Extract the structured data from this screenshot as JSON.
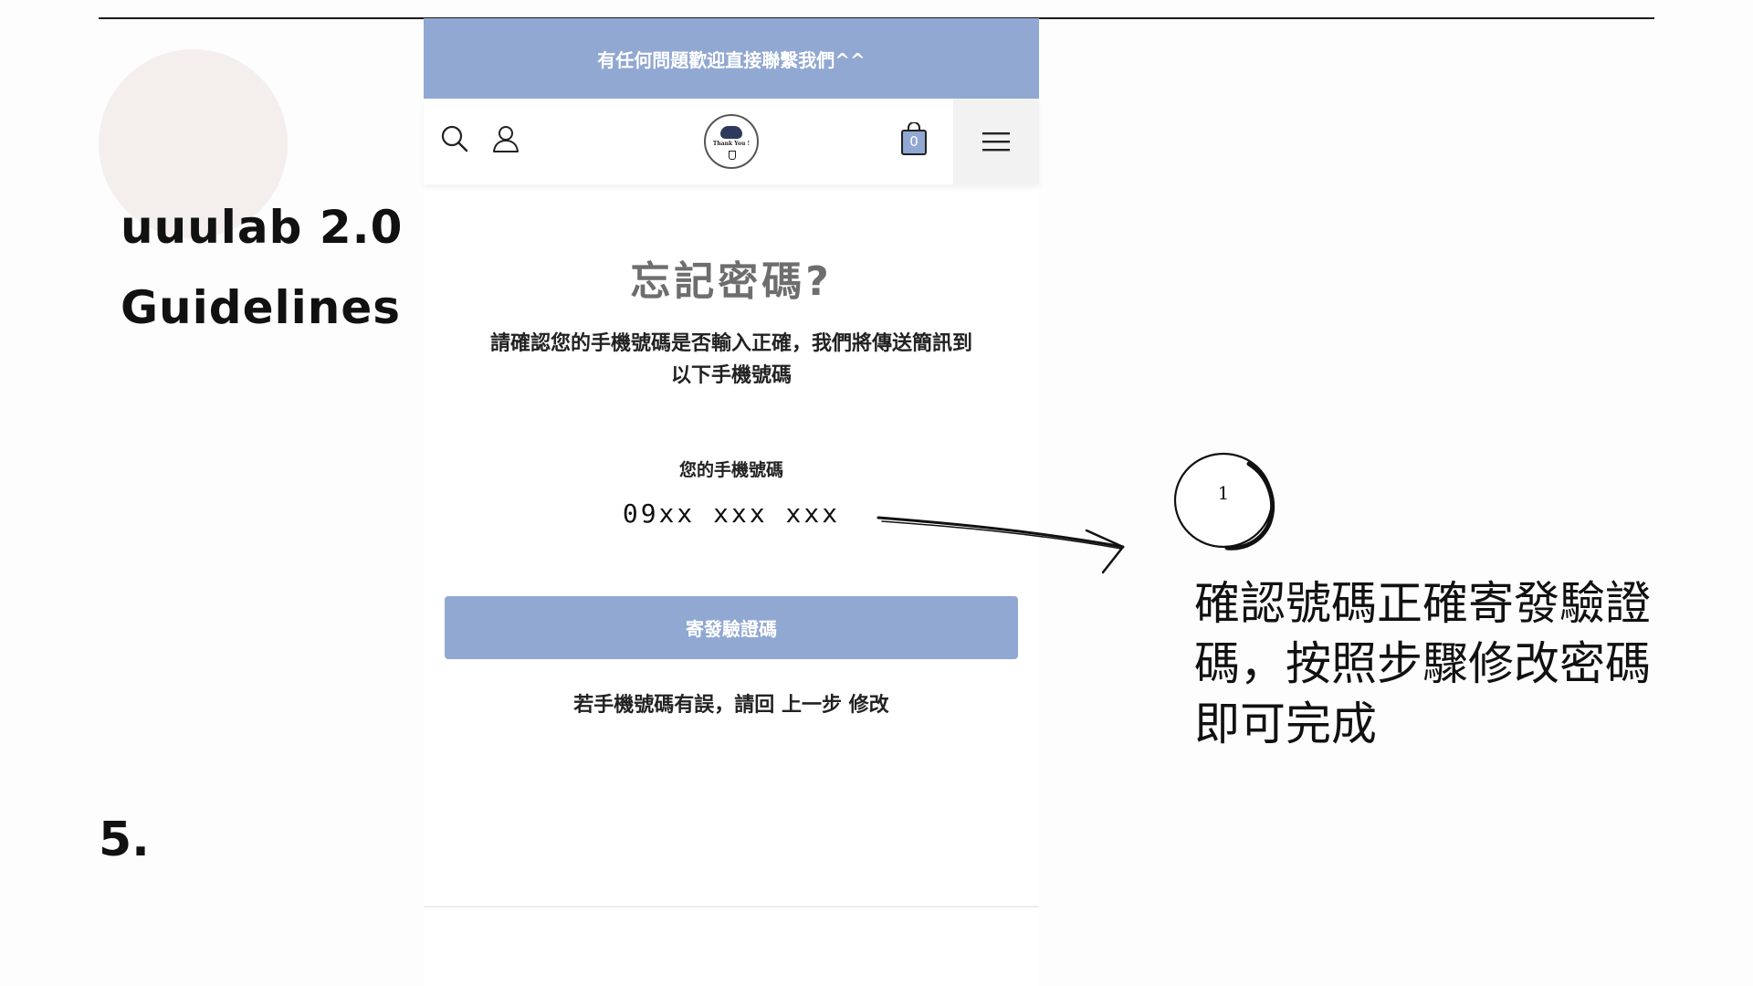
{
  "slide": {
    "title_line1": "uuulab 2.0",
    "title_line2": "Guidelines",
    "step_number": "5.",
    "step_badge": "1",
    "annotation_line1": "確認號碼正確寄發驗證",
    "annotation_line2": "碼，按照步驟修改密碼",
    "annotation_line3": "即可完成"
  },
  "phone": {
    "announcement": "有任何問題歡迎直接聯繫我們^^",
    "header": {
      "search_icon": "search-icon",
      "account_icon": "user-icon",
      "logo_text": "Thank You !",
      "cart_count": "0",
      "menu_icon": "hamburger-menu-icon"
    },
    "page_title": "忘記密碼?",
    "instructions_line1": "請確認您的手機號碼是否輸入正確，我們將傳送簡訊到",
    "instructions_line2": "以下手機號碼",
    "phone_label": "您的手機號碼",
    "phone_value": "09xx xxx xxx",
    "send_button_label": "寄發驗證碼",
    "back_prefix": "若手機號碼有誤，請回",
    "back_link": "上一步",
    "back_suffix": "修改"
  },
  "colors": {
    "accent_blue": "#91a8d2",
    "heading_gray": "#6e6e6e",
    "decor_circle": "#f4efec"
  }
}
